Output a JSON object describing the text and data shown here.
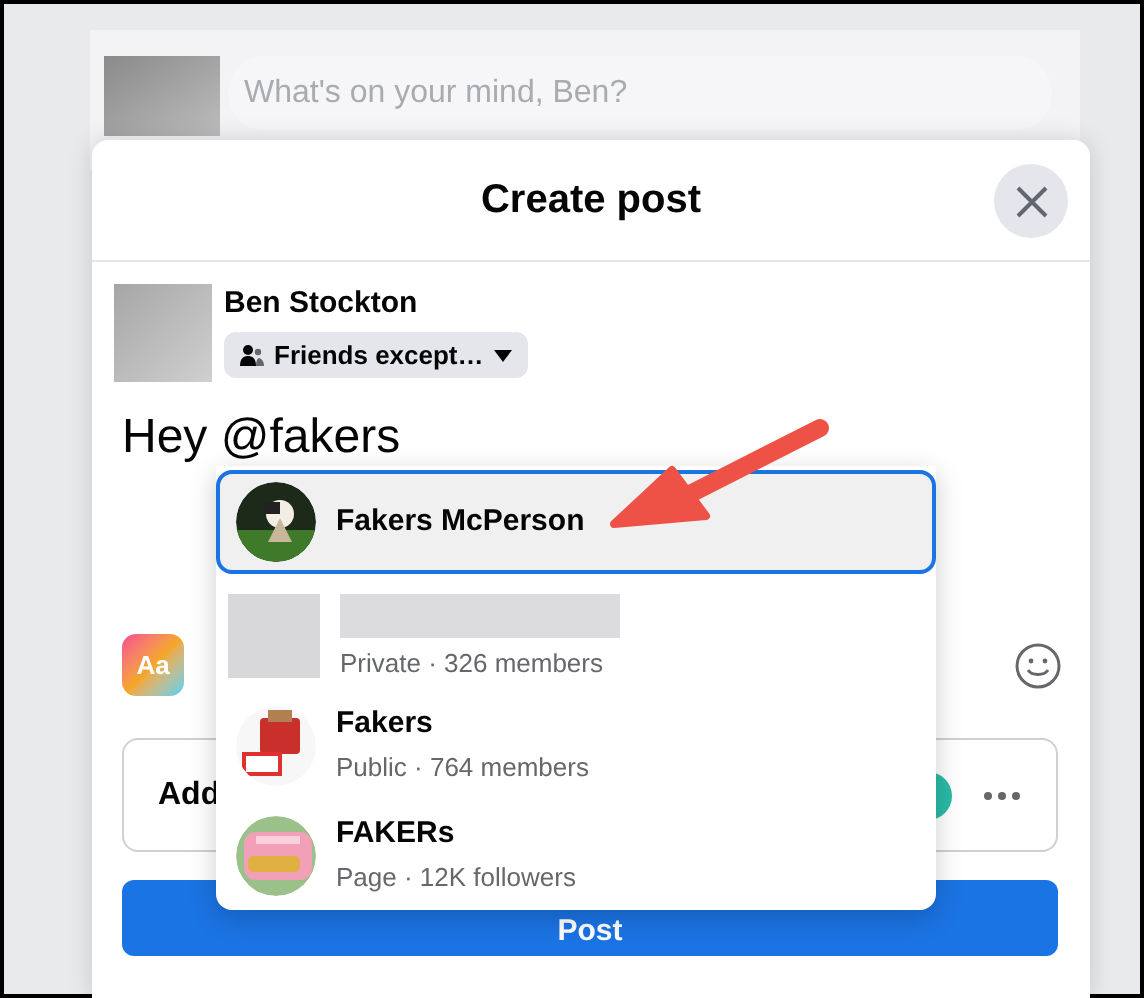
{
  "composer": {
    "placeholder": "What's on your mind, Ben?"
  },
  "dialog": {
    "title": "Create post",
    "author": {
      "name": "Ben Stockton",
      "audience": "Friends except…"
    },
    "post_text": "Hey @fakers",
    "text_style_button": "Aa",
    "add_to_post_label": "Add",
    "post_button": "Post"
  },
  "mention_suggestions": [
    {
      "name": "Fakers McPerson",
      "selected": true
    },
    {
      "kind": "redacted",
      "detail": "Private · 326 members",
      "selected": false
    },
    {
      "name": "Fakers",
      "detail": "Public · 764 members",
      "selected": false
    },
    {
      "name": "FAKERs",
      "detail": "Page · 12K followers",
      "selected": false
    }
  ]
}
